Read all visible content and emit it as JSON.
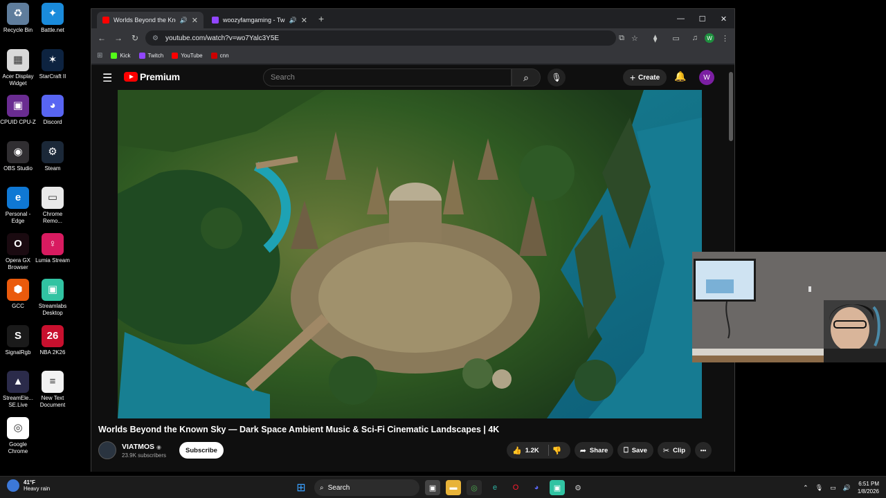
{
  "desktop": {
    "icons": [
      {
        "label": "Recycle Bin",
        "color": "#5f7d9c",
        "glyph": "♻"
      },
      {
        "label": "Battle.net",
        "color": "#1a8bdb",
        "glyph": "✦"
      },
      {
        "label": "Acer Display Widget",
        "color": "#d9d9d9",
        "glyph": "▦"
      },
      {
        "label": "StarCraft II",
        "color": "#0d2340",
        "glyph": "✶"
      },
      {
        "label": "CPUID CPU-Z",
        "color": "#6a2c91",
        "glyph": "▣"
      },
      {
        "label": "Discord",
        "color": "#5865f2",
        "glyph": "◕"
      },
      {
        "label": "OBS Studio",
        "color": "#302e31",
        "glyph": "◉"
      },
      {
        "label": "Steam",
        "color": "#1b2838",
        "glyph": "⚙"
      },
      {
        "label": "Personal - Edge",
        "color": "#0f78d4",
        "glyph": "e"
      },
      {
        "label": "Chrome Remo...",
        "color": "#e9e9e9",
        "glyph": "▭"
      },
      {
        "label": "Opera GX Browser",
        "color": "#1a0a10",
        "glyph": "O"
      },
      {
        "label": "Lumia Stream",
        "color": "#d81b60",
        "glyph": "♀"
      },
      {
        "label": "GCC",
        "color": "#ea5a0c",
        "glyph": "⬢"
      },
      {
        "label": "Streamlabs Desktop",
        "color": "#31c3a2",
        "glyph": "▣"
      },
      {
        "label": "SignalRgb",
        "color": "#1a1a1a",
        "glyph": "S"
      },
      {
        "label": "NBA 2K26",
        "color": "#c8102e",
        "glyph": "26"
      },
      {
        "label": "StreamEle... SE.Live",
        "color": "#2b2b4a",
        "glyph": "▲"
      },
      {
        "label": "New Text Document",
        "color": "#f2f2f2",
        "glyph": "≡"
      },
      {
        "label": "Google Chrome",
        "color": "#ffffff",
        "glyph": "◎"
      }
    ]
  },
  "browser": {
    "tabs": [
      {
        "title": "Worlds Beyond the Known",
        "favicon_color": "#ff0000"
      },
      {
        "title": "woozyfamgaming - Twitch",
        "favicon_color": "#9146ff"
      }
    ],
    "new_tab": "+",
    "window_controls": {
      "minimize": "—",
      "maximize": "☐",
      "close": "✕"
    },
    "url": "youtube.com/watch?v=wo7Yalc3Y5E",
    "profile_initial": "W",
    "bookmarks": [
      {
        "label": "Kick",
        "color": "#53fc18"
      },
      {
        "label": "Twitch",
        "color": "#9146ff"
      },
      {
        "label": "YouTube",
        "color": "#ff0000"
      },
      {
        "label": "cnn",
        "color": "#cc0000"
      }
    ]
  },
  "youtube": {
    "logo_text": "Premium",
    "search_placeholder": "Search",
    "create_label": "Create",
    "avatar_initial": "W",
    "video_title": "Worlds Beyond the Known Sky — Dark Space Ambient Music & Sci-Fi Cinematic Landscapes | 4K",
    "channel_name": "VIATMOS",
    "channel_verified": "◉",
    "subscribers": "23.9K subscribers",
    "subscribe_label": "Subscribe",
    "like_count": "1.2K",
    "share_label": "Share",
    "save_label": "Save",
    "clip_label": "Clip",
    "more_label": "•••"
  },
  "taskbar": {
    "temperature": "41°F",
    "weather": "Heavy rain",
    "search_label": "Search",
    "time": "6:51 PM",
    "date": "1/8/2026"
  }
}
